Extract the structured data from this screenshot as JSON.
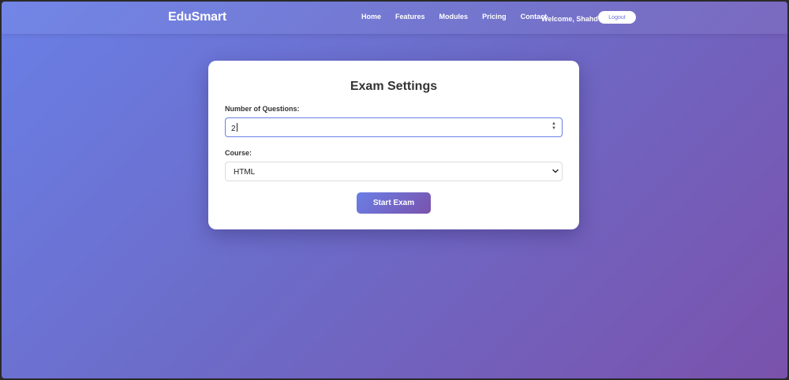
{
  "nav": {
    "brand": "EduSmart",
    "links": [
      "Home",
      "Features",
      "Modules",
      "Pricing",
      "Contact"
    ],
    "welcome": "Welcome, Shahd",
    "logout_label": "Logout"
  },
  "exam_settings": {
    "title": "Exam Settings",
    "questions_label": "Number of Questions:",
    "questions_value": "2",
    "course_label": "Course:",
    "course_selected": "HTML",
    "start_label": "Start Exam"
  },
  "colors": {
    "gradient_start": "#6a7fe6",
    "gradient_end": "#7a52ac",
    "input_focus": "#6a7fe6"
  },
  "icons": {
    "spinner": "spinner-arrows-icon",
    "select": "chevron-down-icon"
  }
}
